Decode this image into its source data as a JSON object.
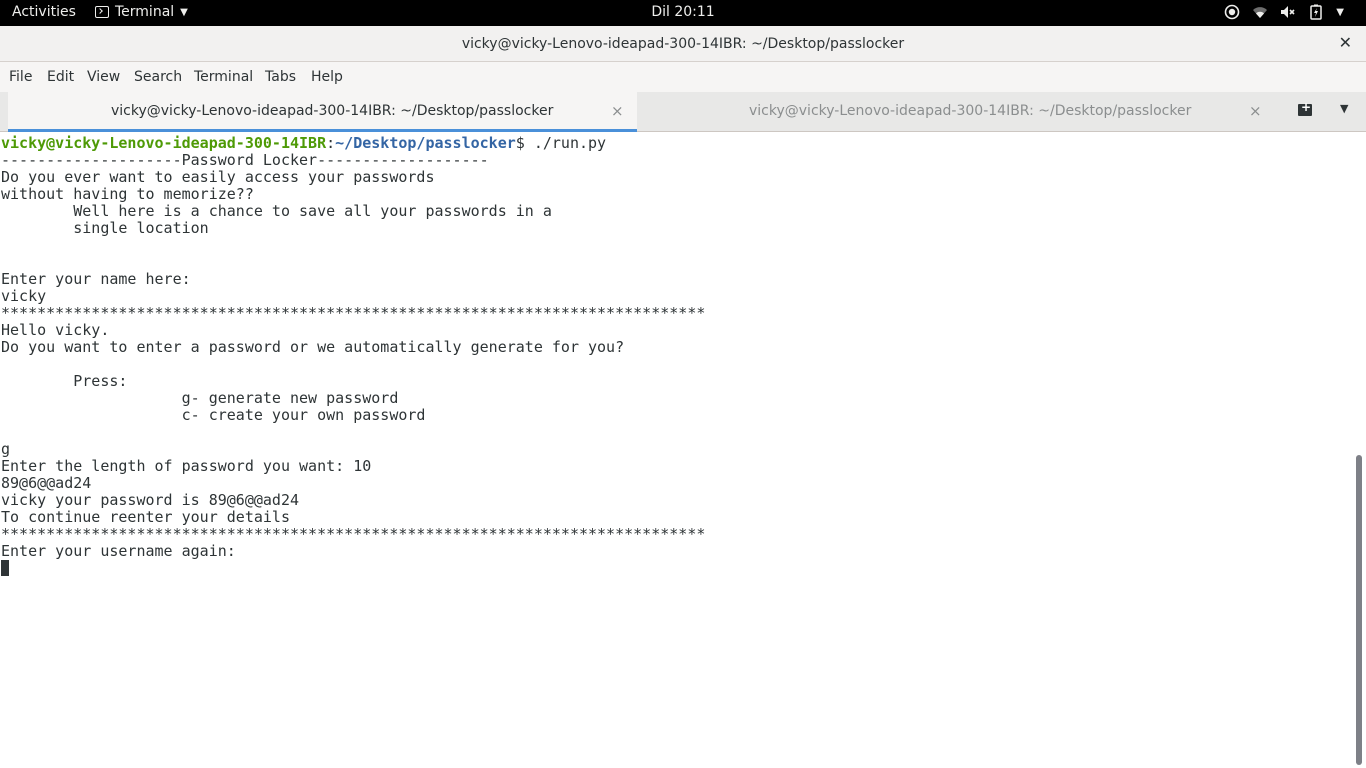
{
  "topbar": {
    "activities": "Activities",
    "app_name": "Terminal",
    "clock": "Dil 20:11",
    "tray_icons": [
      "accessibility-icon",
      "wifi-icon",
      "volume-muted-icon",
      "battery-icon"
    ]
  },
  "window": {
    "title": "vicky@vicky-Lenovo-ideapad-300-14IBR: ~/Desktop/passlocker",
    "close": "✕"
  },
  "menubar": {
    "items": [
      "File",
      "Edit",
      "View",
      "Search",
      "Terminal",
      "Tabs",
      "Help"
    ]
  },
  "tabs": [
    {
      "label": "vicky@vicky-Lenovo-ideapad-300-14IBR: ~/Desktop/passlocker",
      "active": true
    },
    {
      "label": "vicky@vicky-Lenovo-ideapad-300-14IBR: ~/Desktop/passlocker",
      "active": false
    }
  ],
  "terminal": {
    "prompt_user": "vicky@vicky-Lenovo-ideapad-300-14IBR",
    "prompt_sep": ":",
    "prompt_path": "~/Desktop/passlocker",
    "prompt_cmd": "$ ./run.py",
    "lines": [
      "--------------------Password Locker-------------------",
      "Do you ever want to easily access your passwords",
      "without having to memorize??",
      "        Well here is a chance to save all your passwords in a",
      "        single location",
      "",
      "",
      "Enter your name here:",
      "vicky",
      "******************************************************************************",
      "Hello vicky.",
      "Do you want to enter a password or we automatically generate for you?",
      "",
      "        Press:",
      "                    g- generate new password",
      "                    c- create your own password",
      "",
      "g",
      "Enter the length of password you want: 10",
      "89@6@@ad24",
      "vicky your password is 89@6@@ad24",
      "To continue reenter your details",
      "******************************************************************************",
      "Enter your username again:"
    ]
  },
  "colors": {
    "prompt_user": "#4e9a06",
    "prompt_path": "#3465a4",
    "active_tab_underline": "#4a90d9"
  }
}
